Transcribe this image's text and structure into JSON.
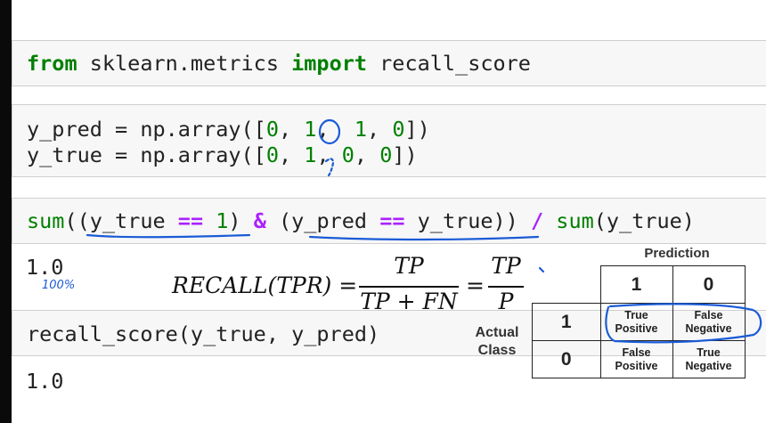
{
  "cells": {
    "import": {
      "kw_from": "from",
      "module": " sklearn.metrics ",
      "kw_import": "import",
      "name": " recall_score"
    },
    "arrays": {
      "line1_pre": "y_pred = np.array([",
      "line1_a": "0",
      "line1_sep1": ", ",
      "line1_b": "1",
      "line1_sep2": ",  ",
      "line1_c": "1",
      "line1_sep3": ", ",
      "line1_d": "0",
      "line1_post": "])",
      "line2_pre": "y_true = np.array([",
      "line2_a": "0",
      "line2_sep1": ", ",
      "line2_b": "1",
      "line2_sep2": ", ",
      "line2_c": "0",
      "line2_sep3": ", ",
      "line2_d": "0",
      "line2_post": "])"
    },
    "sum_expr": {
      "fn1": "sum",
      "part1": "((y_true ",
      "eq1": "==",
      "sp1": " ",
      "one": "1",
      "part2": ") ",
      "amp": "&",
      "part3": " (y_pred ",
      "eq2": "==",
      "part4": " y_true)) ",
      "slash": "/",
      "sp2": " ",
      "fn2": "sum",
      "part5": "(y_true)"
    },
    "sum_output": "1.0",
    "recall_call": "recall_score(y_true, y_pred)",
    "recall_output": "1.0"
  },
  "formula": {
    "lhs": "RECALL(TPR) =",
    "frac1_num": "TP",
    "frac1_den": "TP + FN",
    "eq": "=",
    "frac2_num": "TP",
    "frac2_den": "P"
  },
  "confusion_matrix": {
    "prediction_label": "Prediction",
    "actual_label_1": "Actual",
    "actual_label_2": "Class",
    "col_headers": [
      "1",
      "0"
    ],
    "row_headers": [
      "1",
      "0"
    ],
    "cells": [
      [
        "True\nPositive",
        "False\nNegative"
      ],
      [
        "False\nPositive",
        "True\nNegative"
      ]
    ]
  },
  "annotation_note": "100%",
  "colors": {
    "keyword": "#008000",
    "operator": "#aa22ff",
    "ink": "#1a5bd6"
  }
}
